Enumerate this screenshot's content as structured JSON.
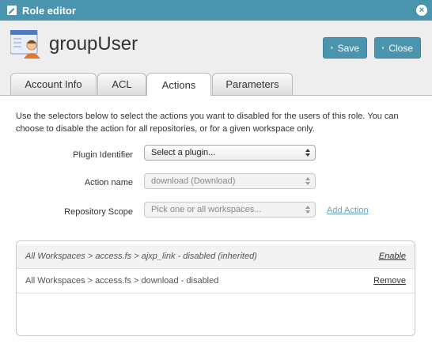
{
  "window": {
    "title": "Role editor"
  },
  "user": {
    "name": "groupUser"
  },
  "buttons": {
    "save": "Save",
    "close": "Close"
  },
  "tabs": [
    {
      "label": "Account Info"
    },
    {
      "label": "ACL"
    },
    {
      "label": "Actions",
      "active": true
    },
    {
      "label": "Parameters"
    }
  ],
  "actions_panel": {
    "description": "Use the selectors below to select the actions you want to disabled for the users of this role. You can choose to disable the action for all repositories, or for a given workspace only.",
    "plugin": {
      "label": "Plugin Identifier",
      "value": "Select a plugin..."
    },
    "action": {
      "label": "Action name",
      "value": "download (Download)"
    },
    "scope": {
      "label": "Repository Scope",
      "value": "Pick one or all workspaces..."
    },
    "add_action": "Add Action"
  },
  "disabled_actions": [
    {
      "text": "All Workspaces > access.fs > ajxp_link - disabled (inherited)",
      "action": "Enable",
      "inherited": true
    },
    {
      "text": "All Workspaces > access.fs > download - disabled",
      "action": "Remove",
      "inherited": false
    }
  ],
  "colors": {
    "accent": "#4a94ad",
    "link": "#6aa2bd"
  }
}
